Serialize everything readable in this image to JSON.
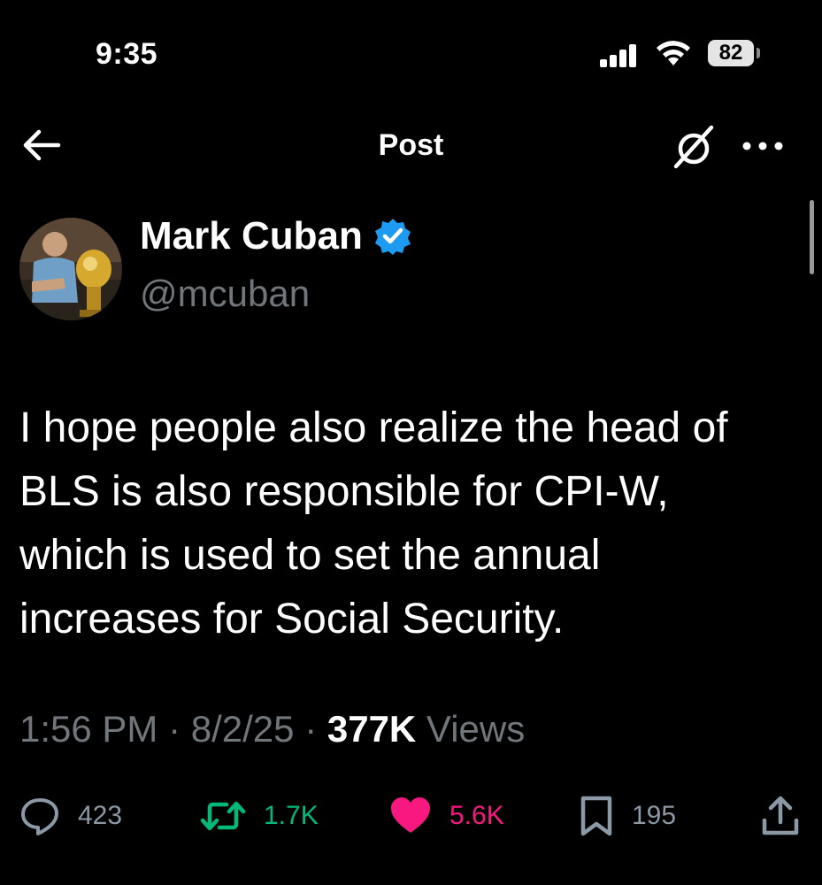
{
  "status_bar": {
    "time": "9:35",
    "battery": "82"
  },
  "header": {
    "title": "Post",
    "icons": [
      "arrow-left-icon",
      "grok-icon",
      "more-dots-icon"
    ]
  },
  "author": {
    "name": "Mark Cuban",
    "handle": "@mcuban",
    "verified": true,
    "verified_color": "#1d9bf0"
  },
  "tweet": {
    "lines": [
      "I hope people also realize the head of",
      "BLS is also responsible for CPI-W,",
      "which is used to set the annual",
      "increases for Social Security."
    ]
  },
  "meta": {
    "time": "1:56 PM",
    "sep": " · ",
    "date": "8/2/25",
    "views_count": "377K",
    "views_label": " Views"
  },
  "actions": {
    "replies": "423",
    "reposts": "1.7K",
    "likes": "5.6K",
    "bookmarks": "195",
    "repost_color": "#00ba7c",
    "like_color": "#f91880"
  }
}
